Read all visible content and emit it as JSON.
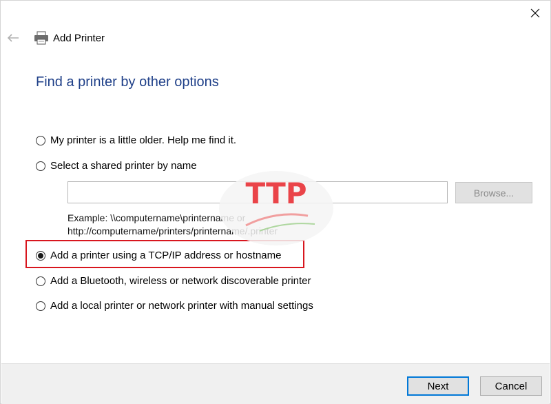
{
  "window": {
    "title": "Add Printer",
    "close_icon": "close-icon",
    "back_icon": "back-arrow-icon",
    "printer_icon": "printer-icon"
  },
  "main": {
    "heading": "Find a printer by other options",
    "options": [
      {
        "label": "My printer is a little older. Help me find it.",
        "selected": false
      },
      {
        "label": "Select a shared printer by name",
        "selected": false
      },
      {
        "label": "Add a printer using a TCP/IP address or hostname",
        "selected": true
      },
      {
        "label": "Add a Bluetooth, wireless or network discoverable printer",
        "selected": false
      },
      {
        "label": "Add a local printer or network printer with manual settings",
        "selected": false
      }
    ],
    "shared_printer_value": "",
    "browse_label": "Browse...",
    "example_line1": "Example: \\\\computername\\printername or",
    "example_line2": "http://computername/printers/printername/.printer"
  },
  "footer": {
    "next_label": "Next",
    "cancel_label": "Cancel"
  },
  "watermark": {
    "text": "TTP"
  },
  "colors": {
    "heading": "#1e3f88",
    "highlight_border": "#d8161e",
    "default_button_border": "#0078d7",
    "watermark_red": "#e8252b"
  }
}
